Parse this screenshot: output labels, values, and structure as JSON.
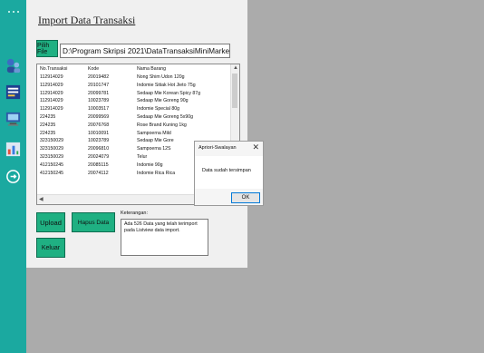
{
  "app": {
    "title": "Import Data Transaksi"
  },
  "toolbar": {
    "pilih_file_label": "Pilih File",
    "file_path": "D:\\Program Skripsi 2021\\DataTransaksiMiniMarket.xlsx"
  },
  "table": {
    "columns": [
      "No.Transaksi",
      "Kode",
      "Nama Barang"
    ],
    "rows": [
      [
        "112914029",
        "20019482",
        "Nong Shim Udon 120g"
      ],
      [
        "112914029",
        "20101747",
        "Indomie Sitiak Hot Jieto 75g"
      ],
      [
        "112914029",
        "20099781",
        "Sedaap Mie Korean Spicy 87g"
      ],
      [
        "112914029",
        "10023789",
        "Sedaap Mie Goreng 90g"
      ],
      [
        "112914029",
        "10003517",
        "Indomie Special 80g"
      ],
      [
        "224235",
        "20099569",
        "Sedaap Mie Goreng 5x90g"
      ],
      [
        "224235",
        "20076768",
        "Rose Brand Kuning 1kg"
      ],
      [
        "224235",
        "10010091",
        "Sampoerna Mild"
      ],
      [
        "323150029",
        "10023789",
        "Sedaap Mie Gore"
      ],
      [
        "323150029",
        "20096810",
        "Sampoerna 12S"
      ],
      [
        "323150029",
        "20024079",
        "Telur"
      ],
      [
        "412150245",
        "20085115",
        "Indomie 90g"
      ],
      [
        "412150245",
        "20074112",
        "Indomie Rica Rica"
      ]
    ]
  },
  "dialog": {
    "title": "Apriori-Swalayan",
    "message": "Data sudah tersimpan",
    "ok_label": "OK"
  },
  "actions": {
    "upload_label": "Upload",
    "hapus_label": "Hapus Data",
    "keluar_label": "Keluar"
  },
  "keterangan": {
    "label": "Keterangan:",
    "text": "Ada 526 Data yang telah terimport pada Listview data import."
  },
  "colors": {
    "sidebar": "#1ba9a0",
    "button_green": "#1fb082",
    "background": "#ababab",
    "panel": "#f0f0f0"
  },
  "sidebar_icons": [
    "menu-dots-icon",
    "user-icon",
    "data-icon",
    "computer-icon",
    "chart-icon",
    "power-icon"
  ]
}
